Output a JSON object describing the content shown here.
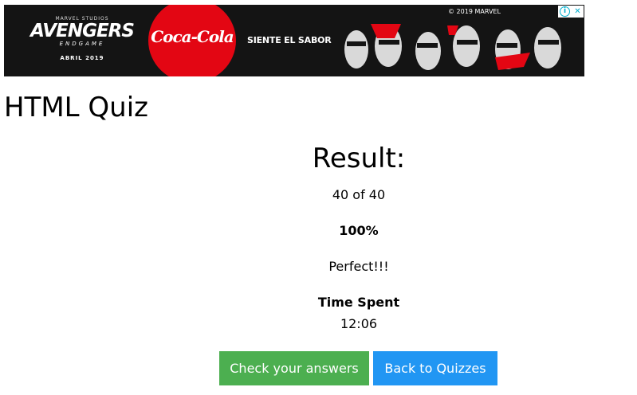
{
  "ad": {
    "studio": "MARVEL STUDIOS",
    "title": "AVENGERS",
    "subtitle": "ENDGAME",
    "date": "ABRIL 2019",
    "brand": "Coca-Cola",
    "slogan": "SIENTE EL SABOR",
    "copyright": "© 2019 MARVEL",
    "info_icon": "info-icon",
    "close_icon": "close-icon",
    "colors": {
      "background": "#141414",
      "brand_red": "#e30613",
      "control_accent": "#00aecd"
    }
  },
  "page": {
    "title": "HTML Quiz"
  },
  "result": {
    "heading": "Result:",
    "score": "40 of 40",
    "percent": "100%",
    "message": "Perfect!!!",
    "time_label": "Time Spent",
    "time_value": "12:06"
  },
  "buttons": {
    "check_answers": "Check your answers",
    "back_to_quizzes": "Back to Quizzes",
    "colors": {
      "check_answers": "#4caf50",
      "back_to_quizzes": "#2196f3"
    }
  }
}
